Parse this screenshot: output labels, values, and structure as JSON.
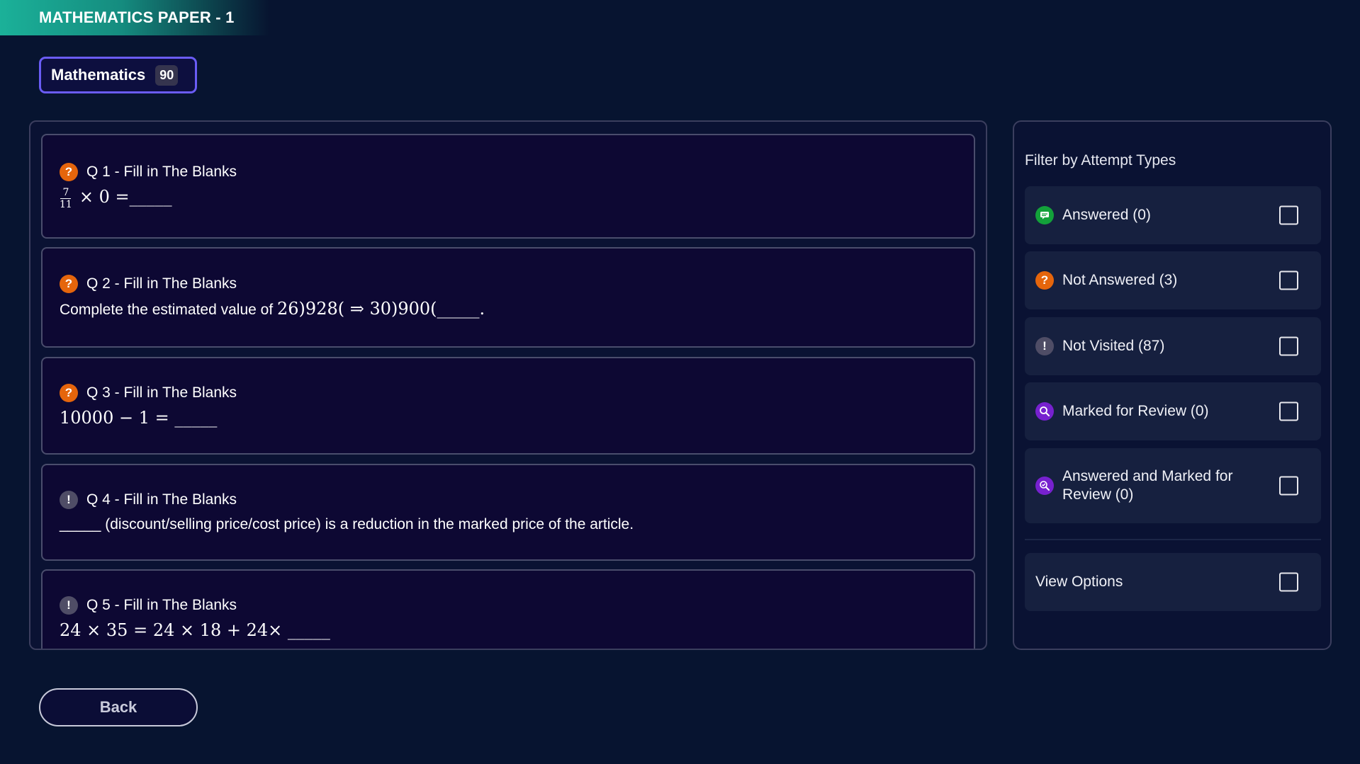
{
  "header": {
    "title": "MATHEMATICS PAPER - 1"
  },
  "subject_tab": {
    "label": "Mathematics",
    "count": "90"
  },
  "questions": [
    {
      "heading": "Q 1 - Fill in The Blanks",
      "status": "not-answered",
      "frac_num": "7",
      "frac_den": "11",
      "body": "× 0 =_____"
    },
    {
      "heading": "Q 2 - Fill in The Blanks",
      "status": "not-answered",
      "body_text": "Complete the estimated value of ",
      "body_math": "26)928(  ⇒  30)900(_____."
    },
    {
      "heading": "Q 3 - Fill in The Blanks",
      "status": "not-answered",
      "body": "10000 − 1 = _____"
    },
    {
      "heading": "Q 4 - Fill in The Blanks",
      "status": "not-visited",
      "body": "_____ (discount/selling price/cost price) is a reduction in the marked price of the article."
    },
    {
      "heading": "Q 5 - Fill in The Blanks",
      "status": "not-visited",
      "body": "24 × 35 = 24 × 18 + 24× _____"
    }
  ],
  "filters": {
    "title": "Filter by Attempt Types",
    "items": [
      {
        "label": "Answered (0)",
        "icon": "answered-icon"
      },
      {
        "label": "Not Answered (3)",
        "icon": "question-mark-icon"
      },
      {
        "label": "Not Visited (87)",
        "icon": "exclamation-icon"
      },
      {
        "label": "Marked for Review (0)",
        "icon": "magnifier-icon"
      },
      {
        "label": "Answered and Marked for Review (0)",
        "icon": "magnifier-check-icon"
      }
    ],
    "view_options": "View Options"
  },
  "footer": {
    "back_label": "Back"
  },
  "colors": {
    "background": "#071430",
    "accent": "#6a5cf5",
    "banner": "#1bb199",
    "not_answered": "#e5650c",
    "not_visited": "#4f4d66",
    "answered": "#13a13a",
    "review": "#7721cf"
  }
}
